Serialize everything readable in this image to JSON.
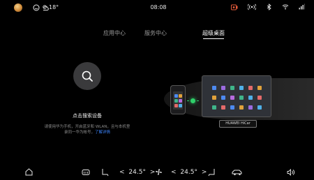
{
  "status_bar": {
    "temperature": "18°",
    "time": "08:08"
  },
  "tabs": [
    {
      "label": "应用中心",
      "active": false
    },
    {
      "label": "服务中心",
      "active": false
    },
    {
      "label": "超级桌面",
      "active": true
    }
  ],
  "search": {
    "title": "点击搜索设备",
    "hint_line1": "请使用华为手机，开启蓝牙和 WLAN，且与本机登",
    "hint_line2_prefix": "录同一华为帐号，",
    "hint_link": "了解详情"
  },
  "illustration": {
    "label": "HUAWEI HiCar"
  },
  "dock": {
    "left_temp": "24.5°",
    "right_temp": "24.5°",
    "left_arrow_prev": "<",
    "left_arrow_next": ">",
    "right_arrow_prev": "<",
    "right_arrow_next": ">"
  },
  "colors": {
    "background": "#000000",
    "link": "#3b82f6",
    "connection": "#2fd06a"
  }
}
